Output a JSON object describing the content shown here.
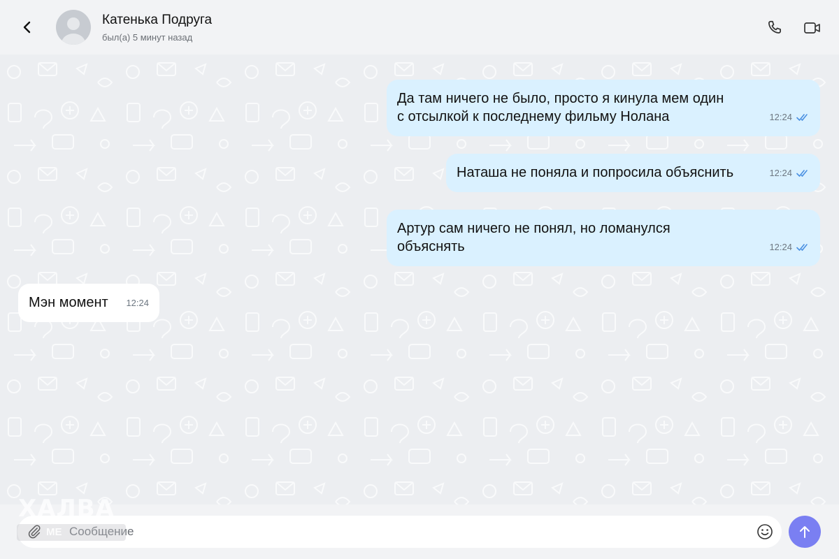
{
  "header": {
    "contact_name": "Катенька Подруга",
    "status": "был(а) 5 минут назад",
    "icons": [
      "chevron-left-icon",
      "phone-icon",
      "video-camera-icon"
    ]
  },
  "messages": [
    {
      "direction": "outgoing",
      "text": "Да там ничего не было, просто я кинула мем один\nс отсылкой к последнему фильму Нолана",
      "time": "12:24",
      "read": true
    },
    {
      "direction": "outgoing",
      "text": "Наташа не поняла и попросила объяснить",
      "time": "12:24",
      "read": true
    },
    {
      "direction": "outgoing",
      "text": "Артур сам ничего не понял, но ломанулся\nобъяснять",
      "time": "12:24",
      "read": true
    },
    {
      "direction": "incoming",
      "text": "Мэн момент",
      "time": "12:24"
    }
  ],
  "composer": {
    "placeholder": "Сообщение",
    "icons": [
      "paperclip-icon",
      "emoji-icon",
      "arrow-up-icon"
    ]
  },
  "watermark": {
    "top": "ХАЛВА",
    "bottom": "МЕ"
  },
  "colors": {
    "background": "#eceef1",
    "outgoing_bubble": "#daf1ff",
    "incoming_bubble": "#ffffff",
    "send_button": "#7a7ff2",
    "read_check": "#4a90e2"
  }
}
